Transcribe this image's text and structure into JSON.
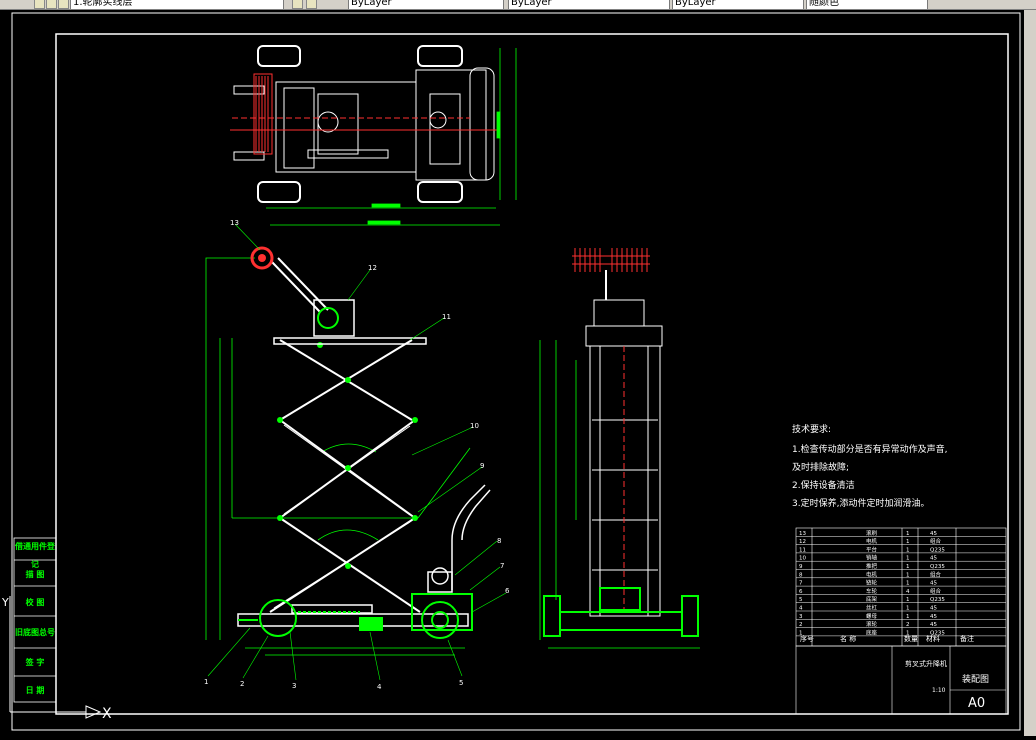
{
  "toolbar": {
    "layer_value": "1.轮廓实线层",
    "color_value": "ByLayer",
    "linetype_value": "ByLayer",
    "lineweight_value": "ByLayer",
    "plotstyle_value": "随颜色"
  },
  "tech_requirements": {
    "title": "技术要求:",
    "line1": "1.检查传动部分是否有异常动作及声音,",
    "line1b": "及时排除故障;",
    "line2": "2.保持设备清洁",
    "line3": "3.定时保养,添动件定时加润滑油。"
  },
  "balloons": [
    "1",
    "2",
    "3",
    "4",
    "5",
    "6",
    "7",
    "8",
    "9",
    "10",
    "11",
    "12",
    "13"
  ],
  "side_table": [
    "借通用件登记",
    "描 图",
    "校 图",
    "旧底图总号",
    "签 字",
    "日 期"
  ],
  "title_block": {
    "drawing_title": "剪叉式升降机",
    "drawing_type": "装配图",
    "size": "A0",
    "scale": "1:10"
  },
  "bom_rows": [
    {
      "no": "13",
      "name": "滚刷",
      "qty": "1",
      "mat": "45"
    },
    {
      "no": "12",
      "name": "电机",
      "qty": "1",
      "mat": "组合"
    },
    {
      "no": "11",
      "name": "平台",
      "qty": "1",
      "mat": "Q235"
    },
    {
      "no": "10",
      "name": "销轴",
      "qty": "1",
      "mat": "45"
    },
    {
      "no": "9",
      "name": "推把",
      "qty": "1",
      "mat": "Q235"
    },
    {
      "no": "8",
      "name": "电机",
      "qty": "1",
      "mat": "组合"
    },
    {
      "no": "7",
      "name": "链轮",
      "qty": "1",
      "mat": "45"
    },
    {
      "no": "6",
      "name": "车轮",
      "qty": "4",
      "mat": "组合"
    },
    {
      "no": "5",
      "name": "底架",
      "qty": "1",
      "mat": "Q235"
    },
    {
      "no": "4",
      "name": "丝杠",
      "qty": "1",
      "mat": "45"
    },
    {
      "no": "3",
      "name": "螺母",
      "qty": "1",
      "mat": "45"
    },
    {
      "no": "2",
      "name": "滚轮",
      "qty": "2",
      "mat": "45"
    },
    {
      "no": "1",
      "name": "底座",
      "qty": "1",
      "mat": "Q235"
    }
  ],
  "bom_header": {
    "no": "序号",
    "name": "名 称",
    "qty": "数量",
    "mat": "材料",
    "note": "备注"
  },
  "ucs": {
    "x": "X",
    "y": "Y"
  },
  "colors": {
    "green": "#00ff00",
    "white": "#ffffff",
    "red": "#ff2020",
    "yellow": "#ffff00"
  }
}
